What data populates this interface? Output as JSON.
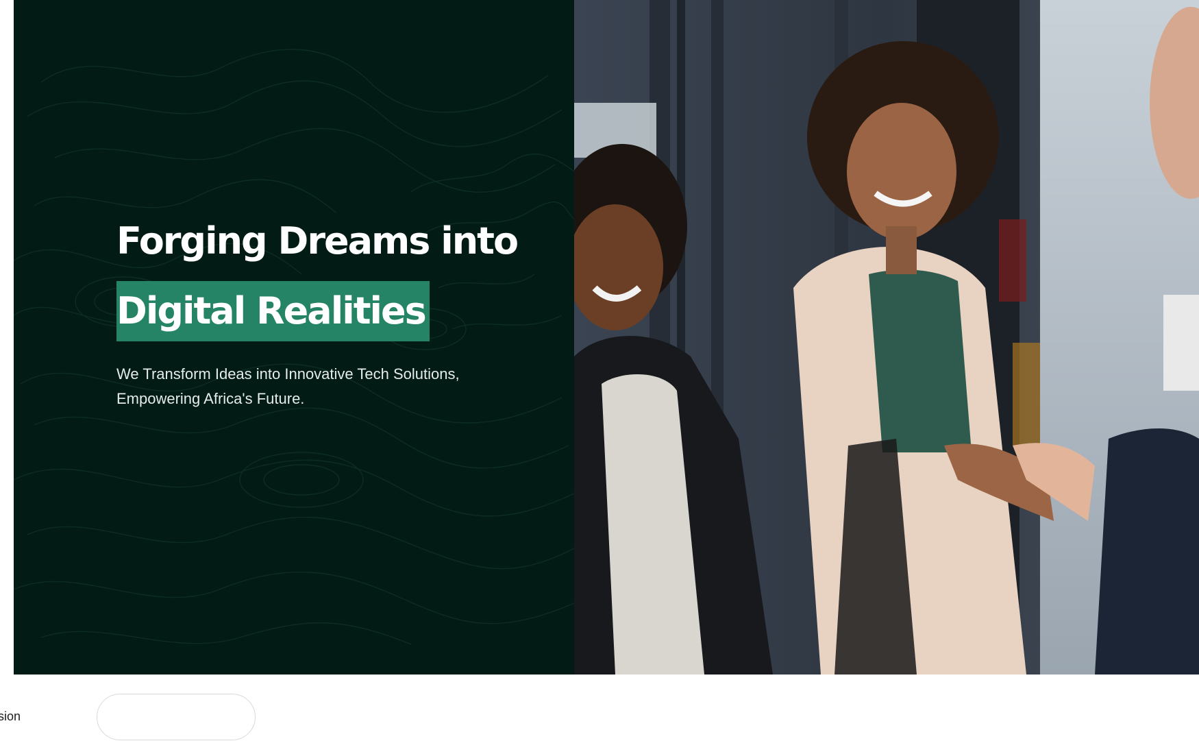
{
  "hero": {
    "headline_line1": "Forging Dreams into",
    "headline_line2": "Digital Realities",
    "subtitle": "We Transform Ideas into Innovative Tech Solutions, Empowering Africa's Future."
  },
  "bottom": {
    "session_label": "ession",
    "pill_button_label": ""
  },
  "colors": {
    "hero_background": "#021b15",
    "highlight": "#258466",
    "text_light": "#ffffff"
  }
}
